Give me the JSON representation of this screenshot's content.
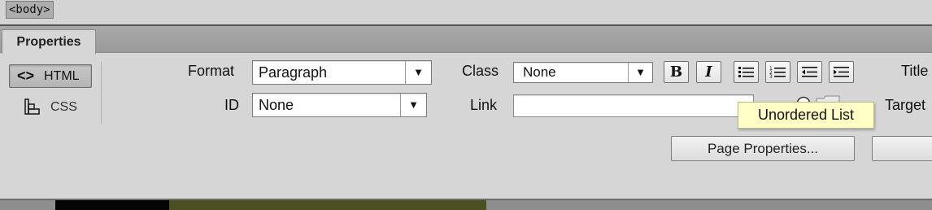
{
  "tag_selector": {
    "current_tag": "<body>"
  },
  "panel": {
    "tab_label": "Properties"
  },
  "mode_switch": {
    "html_label": "HTML",
    "html_icon": "code-brackets-icon",
    "css_label": "CSS",
    "css_icon": "css-grid-icon"
  },
  "format": {
    "label": "Format",
    "value": "Paragraph"
  },
  "id_field": {
    "label": "ID",
    "value": "None"
  },
  "class_field": {
    "label": "Class",
    "value": "None"
  },
  "link_field": {
    "label": "Link",
    "value": ""
  },
  "format_buttons": {
    "bold": {
      "glyph": "B",
      "icon": "bold-icon"
    },
    "italic": {
      "glyph": "I",
      "icon": "italic-icon"
    },
    "unordered_list": {
      "icon": "unordered-list-icon"
    },
    "ordered_list": {
      "icon": "ordered-list-icon"
    },
    "outdent": {
      "icon": "outdent-icon"
    },
    "indent": {
      "icon": "indent-icon"
    }
  },
  "right_labels": {
    "title": "Title",
    "target": "Target"
  },
  "tooltip": {
    "text": "Unordered List"
  },
  "page_properties_button": {
    "label": "Page Properties..."
  },
  "colors": {
    "panel_bg": "#d6d6d6",
    "tab_row": "#a3a3a3",
    "tooltip_bg": "#ffffc6"
  }
}
